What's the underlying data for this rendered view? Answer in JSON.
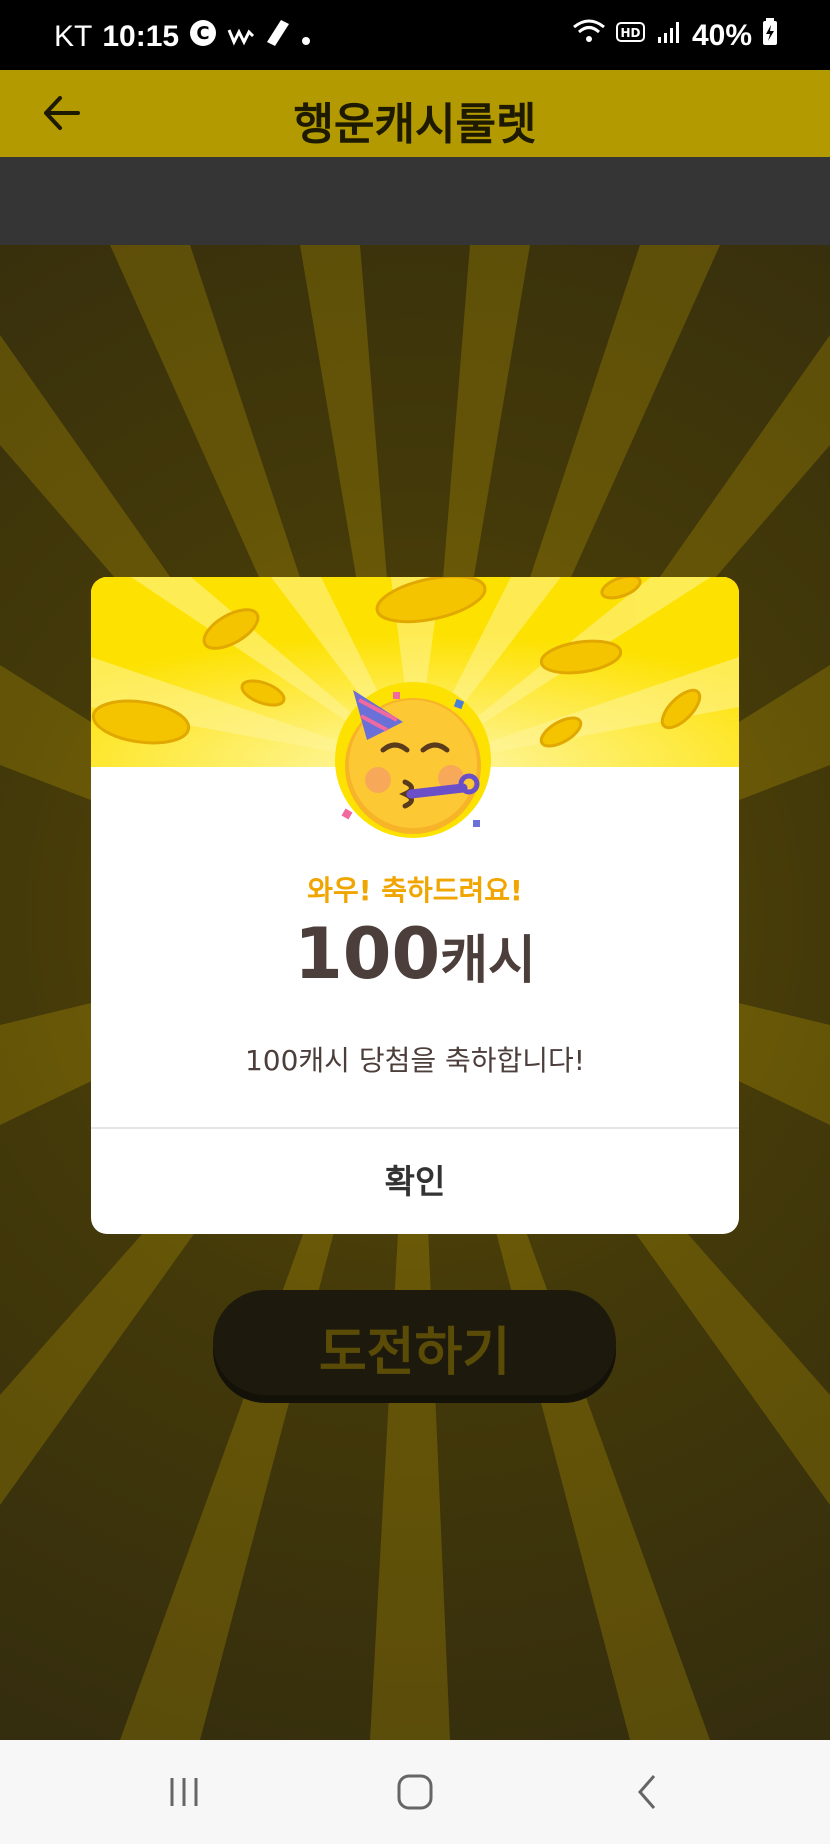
{
  "status_bar": {
    "carrier": "KT",
    "time": "10:15",
    "battery": "40%"
  },
  "header": {
    "title": "행운캐시룰렛"
  },
  "game": {
    "challenge_label": "도전하기"
  },
  "dialog": {
    "headline": "와우! 축하드려요!",
    "amount_number": "100",
    "amount_unit": "캐시",
    "message": "100캐시 당첨을 축하합니다!",
    "confirm_label": "확인"
  },
  "colors": {
    "brand_yellow": "#fde100",
    "headline_orange": "#f0a500",
    "text_dark": "#4c3f3b"
  },
  "icons": {
    "back": "arrow-left-icon",
    "recents": "recent-apps-icon",
    "home": "home-icon",
    "nav_back": "chevron-left-icon"
  }
}
